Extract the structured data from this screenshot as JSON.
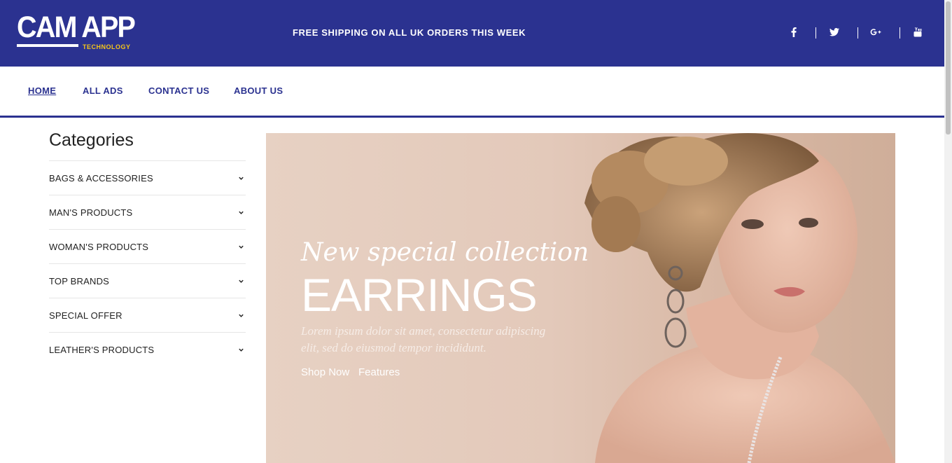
{
  "header": {
    "logo_main": "CAM APP",
    "logo_sub": "TECHNOLOGY",
    "promo": "FREE SHIPPING ON ALL UK ORDERS THIS WEEK",
    "social": [
      "facebook-icon",
      "twitter-icon",
      "google-plus-icon",
      "youtube-icon"
    ]
  },
  "nav": {
    "items": [
      "HOME",
      "ALL ADS",
      "CONTACT US",
      "ABOUT US"
    ],
    "active": "HOME"
  },
  "sidebar": {
    "title": "Categories",
    "items": [
      "BAGS & ACCESSORIES",
      "MAN'S PRODUCTS",
      "WOMAN'S PRODUCTS",
      "TOP BRANDS",
      "SPECIAL OFFER",
      "LEATHER'S PRODUCTS"
    ]
  },
  "hero": {
    "tagline": "New special collection",
    "title": "EARRINGS",
    "description": "Lorem ipsum dolor sit amet, consectetur adipiscing elit, sed do eiusmod tempor incididunt.",
    "button_shop": "Shop Now",
    "button_features": "Features"
  },
  "colors": {
    "brand": "#2b3290",
    "logo_accent": "#f5c518",
    "hero_bg": "#e3c9ba"
  }
}
